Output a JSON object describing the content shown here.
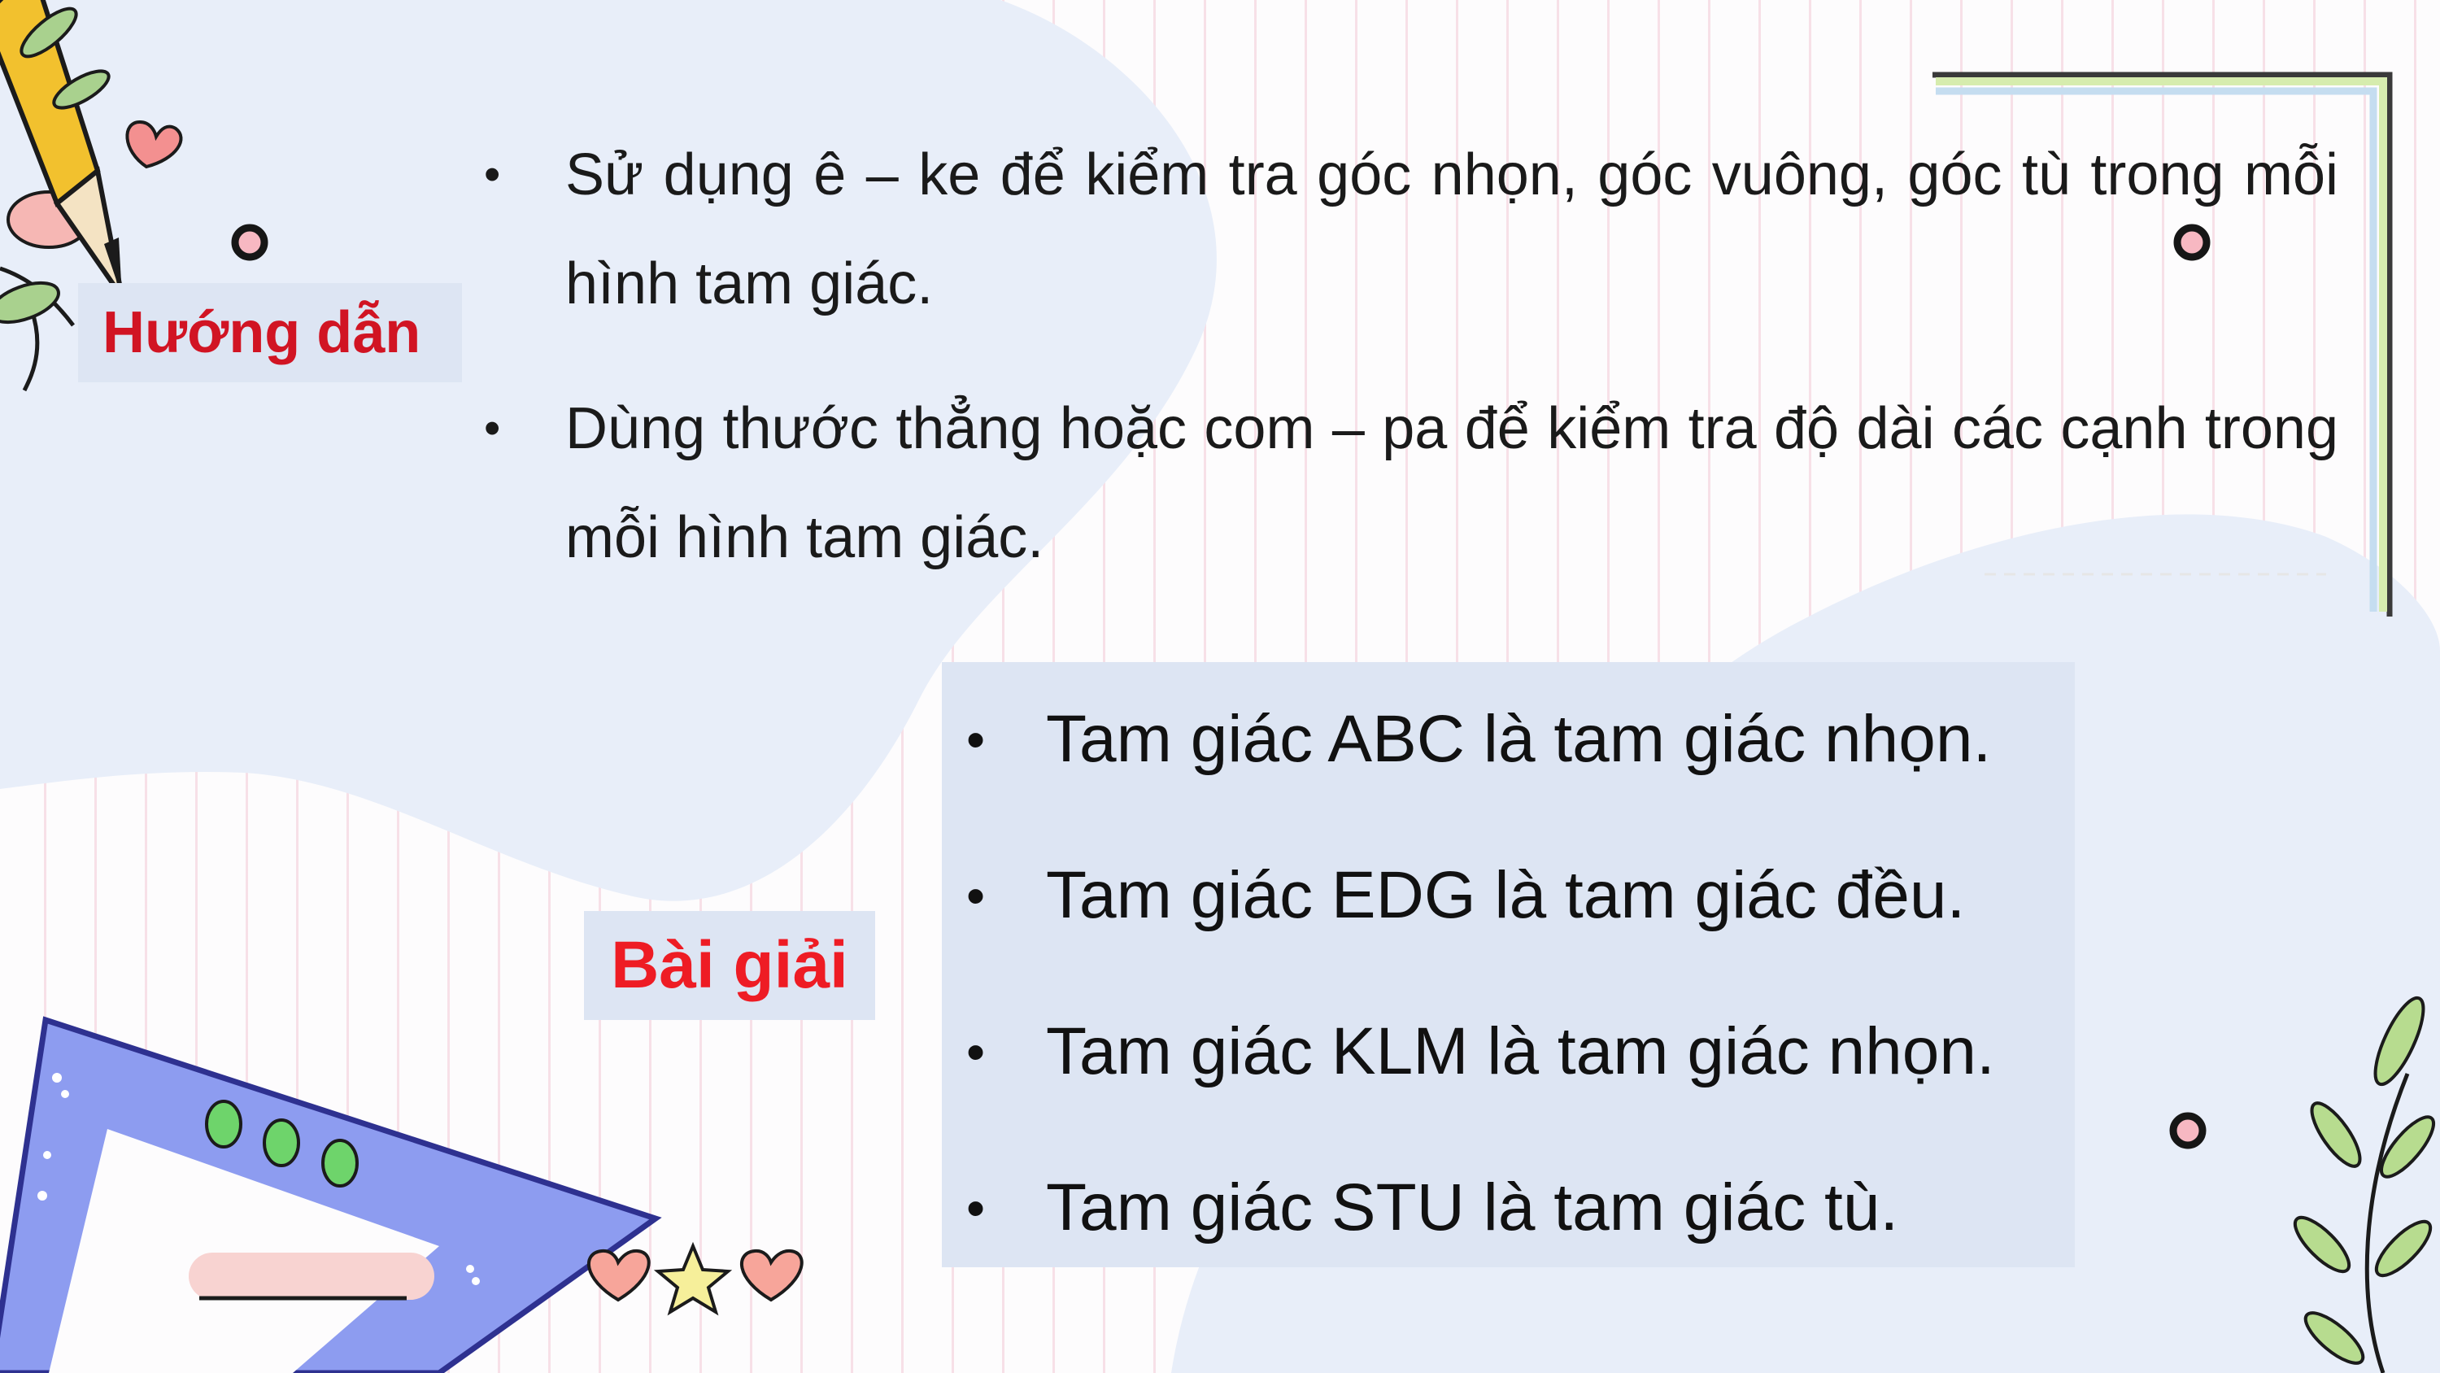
{
  "guide": {
    "heading": "Hướng dẫn",
    "items": [
      {
        "text": "Sử dụng ê – ke để kiểm tra góc nhọn, góc vuông, góc tù trong mỗi hình tam giác."
      },
      {
        "text": "Dùng thước thẳng hoặc com – pa để kiểm tra độ dài các cạnh trong mỗi hình tam giác."
      }
    ]
  },
  "solution": {
    "heading": "Bài giải",
    "items": [
      {
        "text": "Tam giác ABC là tam giác nhọn."
      },
      {
        "text": "Tam giác EDG là tam giác đều."
      },
      {
        "text": "Tam giác KLM là tam giác nhọn."
      },
      {
        "text": "Tam giác STU là tam giác tù."
      }
    ]
  },
  "colors": {
    "heading_red": "#d11423",
    "label_bg": "#dde5f3",
    "blob_blue": "#e8eef9",
    "ruler_blue": "#8d9cf0"
  },
  "decorations": [
    "pencil-icon",
    "heart-icon",
    "star-icon",
    "leaf-sprig-icon",
    "set-square-icon",
    "ring-dot-icon"
  ]
}
